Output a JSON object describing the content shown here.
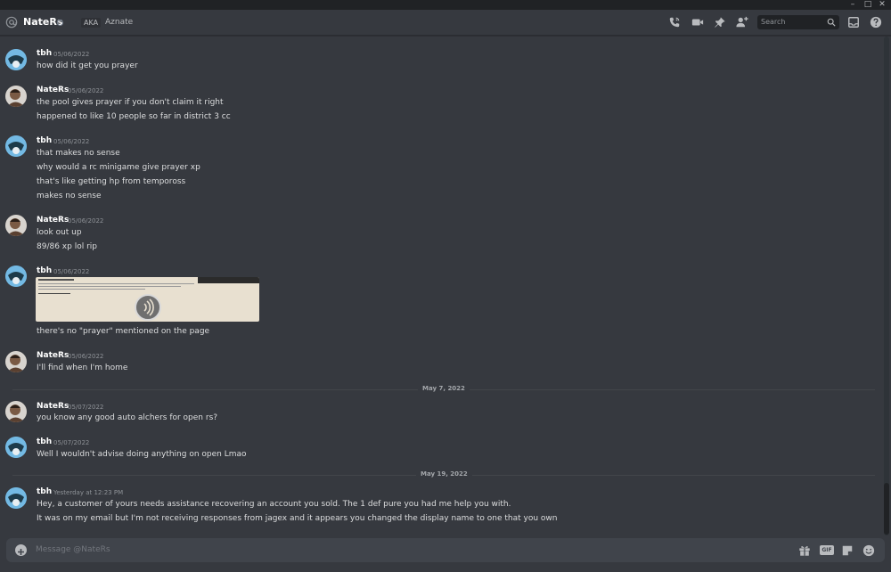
{
  "window": {
    "minimize": "–",
    "maximize": "□",
    "close": "✕"
  },
  "header": {
    "channel_name": "NateRs",
    "aka_label": "AKA",
    "aka_name": "Aznate",
    "search_placeholder": "Search",
    "icons": [
      "at-icon",
      "voice-call-icon",
      "video-call-icon",
      "pin-icon",
      "add-friend-icon",
      "search-icon",
      "inbox-icon",
      "help-icon"
    ]
  },
  "messages": [
    {
      "author": "tbh",
      "avatar": "tbh",
      "timestamp": "05/06/2022",
      "lines": [
        "how did it get you prayer"
      ]
    },
    {
      "author": "NateRs",
      "avatar": "nate",
      "timestamp": "05/06/2022",
      "lines": [
        "the pool gives prayer if you don't claim it right",
        "happened to like 10 people so far in district 3 cc"
      ]
    },
    {
      "author": "tbh",
      "avatar": "tbh",
      "timestamp": "05/06/2022",
      "lines": [
        "that makes no sense",
        "why would a rc minigame give prayer xp",
        "that's like getting hp from tempoross",
        "makes no sense"
      ]
    },
    {
      "author": "NateRs",
      "avatar": "nate",
      "timestamp": "05/06/2022",
      "lines": [
        "look out up",
        "89/86 xp lol rip"
      ]
    },
    {
      "author": "tbh",
      "avatar": "tbh",
      "timestamp": "05/06/2022",
      "lines": [
        "there's no \"prayer\" mentioned on the page"
      ]
    },
    {
      "author": "NateRs",
      "avatar": "nate",
      "timestamp": "05/06/2022",
      "lines": [
        "I'll find when I'm home"
      ]
    },
    {
      "author": "NateRs",
      "avatar": "nate",
      "timestamp": "05/07/2022",
      "lines": [
        "you know any good auto alchers for open rs?"
      ]
    },
    {
      "author": "tbh",
      "avatar": "tbh",
      "timestamp": "05/07/2022",
      "lines": [
        "Well I wouldn't advise doing anything on open Lmao"
      ]
    },
    {
      "author": "tbh",
      "avatar": "tbh",
      "timestamp": "Yesterday at 12:23 PM",
      "lines": [
        "Hey, a customer of yours needs assistance recovering an account you sold. The 1 def pure you had me help you with.",
        "It was on my email but I'm not receiving responses from jagex and it appears you changed the display name to one that you own"
      ]
    }
  ],
  "dividers": [
    "May 7, 2022",
    "May 19, 2022"
  ],
  "composer": {
    "placeholder": "Message @NateRs",
    "gif_label": "GIF",
    "icons": [
      "add-attachment-icon",
      "gift-icon",
      "gif-icon",
      "sticker-icon",
      "emoji-icon"
    ]
  },
  "colors": {
    "background": "#36393f",
    "header": "#36393f",
    "titlebar": "#202225",
    "composer": "#40444b",
    "text": "#dcddde",
    "muted": "#8e9297"
  }
}
